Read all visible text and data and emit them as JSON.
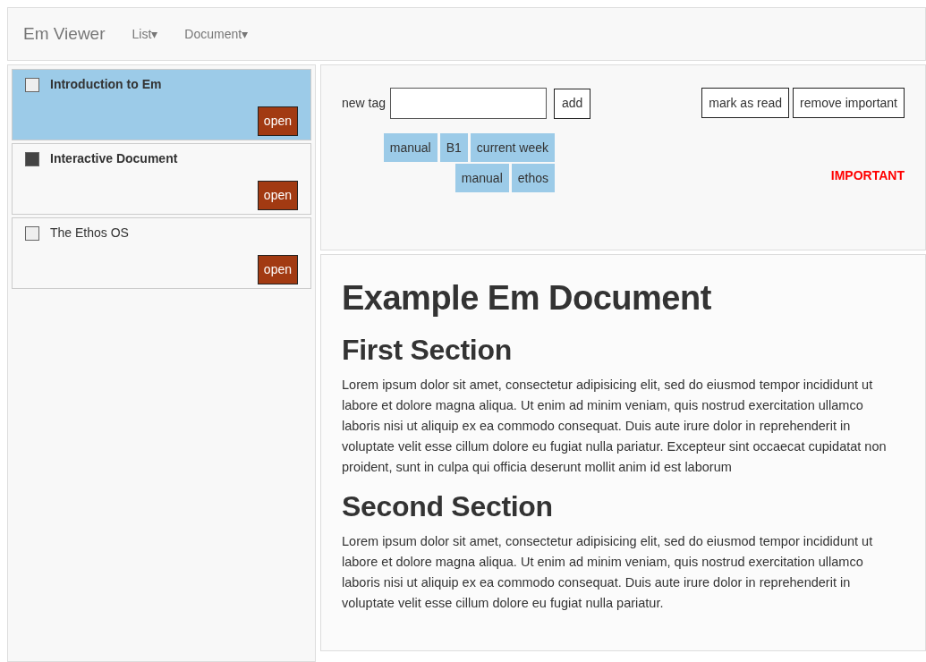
{
  "navbar": {
    "brand": "Em Viewer",
    "menus": [
      {
        "label": "List",
        "caret": "▾"
      },
      {
        "label": "Document",
        "caret": "▾"
      }
    ]
  },
  "list": [
    {
      "title": "Introduction to Em",
      "selected": true,
      "unread": true,
      "checked": false,
      "button": "open"
    },
    {
      "title": "Interactive Document",
      "selected": false,
      "unread": true,
      "checked": true,
      "button": "open"
    },
    {
      "title": "The Ethos OS",
      "selected": false,
      "unread": false,
      "checked": false,
      "button": "open"
    }
  ],
  "toolbar": {
    "new_tag_label": "new tag",
    "add_button": "add",
    "actions": [
      "mark as read",
      "remove important"
    ],
    "important": "IMPORTANT",
    "tag_rows": [
      [
        "manual",
        "B1",
        "current week"
      ],
      [
        "manual",
        "ethos"
      ]
    ]
  },
  "document": {
    "title": "Example Em Document",
    "sections": [
      {
        "heading": "First Section",
        "text": "Lorem ipsum dolor sit amet, consectetur adipisicing elit, sed do eiusmod tempor incididunt ut labore et dolore magna aliqua. Ut enim ad minim veniam, quis nostrud exercitation ullamco laboris nisi ut aliquip ex ea commodo consequat. Duis aute irure dolor in reprehenderit in voluptate velit esse cillum dolore eu fugiat nulla pariatur. Excepteur sint occaecat cupidatat non proident, sunt in culpa qui officia deserunt mollit anim id est laborum"
      },
      {
        "heading": "Second Section",
        "text": "Lorem ipsum dolor sit amet, consectetur adipisicing elit, sed do eiusmod tempor incididunt ut labore et dolore magna aliqua. Ut enim ad minim veniam, quis nostrud exercitation ullamco laboris nisi ut aliquip ex ea commodo consequat. Duis aute irure dolor in reprehenderit in voluptate velit esse cillum dolore eu fugiat nulla pariatur."
      }
    ]
  }
}
